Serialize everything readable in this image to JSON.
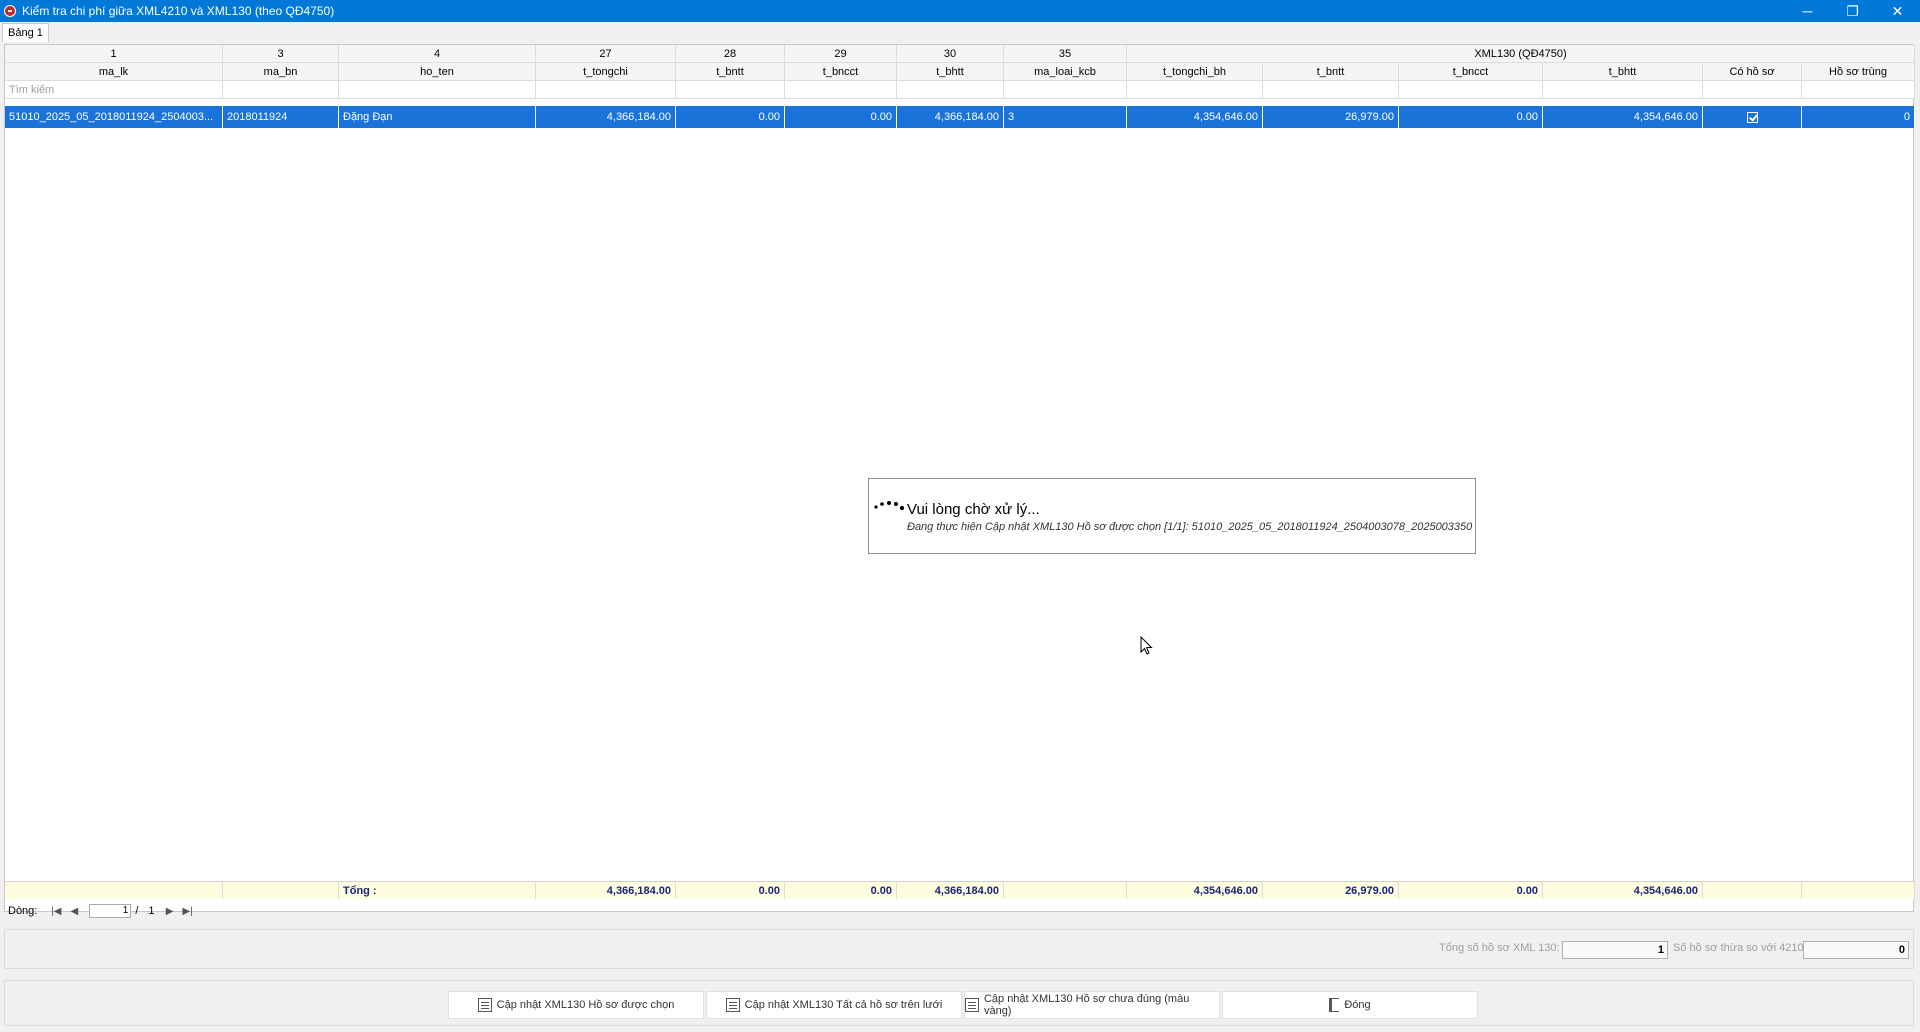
{
  "window": {
    "title": "Kiểm tra chi phí giữa XML4210 và XML130 (theo QĐ4750)",
    "minimize": "─",
    "restore": "❐",
    "close": "✕"
  },
  "tabs": [
    {
      "label": "Bảng 1"
    }
  ],
  "grid": {
    "header_numbers": [
      "1",
      "3",
      "4",
      "27",
      "28",
      "29",
      "30",
      "35"
    ],
    "header_group": "XML130 (QĐ4750)",
    "columns": [
      "ma_lk",
      "ma_bn",
      "ho_ten",
      "t_tongchi",
      "t_bntt",
      "t_bncct",
      "t_bhtt",
      "ma_loai_kcb",
      "t_tongchi_bh",
      "t_bntt",
      "t_bncct",
      "t_bhtt",
      "Có hồ sơ",
      "Hồ sơ trùng"
    ],
    "search_placeholder": "Tìm kiếm",
    "rows": [
      [
        "51010_2025_05_2018011924_2504003...",
        "2018011924",
        "Đặng Đạn",
        "4,366,184.00",
        "0.00",
        "0.00",
        "4,366,184.00",
        "3",
        "4,354,646.00",
        "26,979.00",
        "0.00",
        "4,354,646.00",
        "",
        "0"
      ]
    ],
    "row_checked": true,
    "totals": {
      "label": "Tổng :",
      "values": [
        "4,366,184.00",
        "0.00",
        "0.00",
        "4,366,184.00",
        "",
        "4,354,646.00",
        "26,979.00",
        "0.00",
        "4,354,646.00"
      ]
    }
  },
  "pager": {
    "label": "Dòng:",
    "current_page": "1",
    "separator": "/",
    "total_pages": "1",
    "first": "|◀",
    "prev": "◀",
    "next": "▶",
    "last": "▶|"
  },
  "summary": {
    "total_label": "Tổng số hồ sơ XML 130:",
    "total_value": "1",
    "excess_label": "Số hồ sơ thừa so với 4210:",
    "excess_value": "0"
  },
  "buttons": {
    "update_selected": "Cập nhật XML130 Hồ sơ được chọn",
    "update_all": "Cập nhật XML130 Tất cả hồ sơ trên lưới",
    "update_incorrect": "Cập nhật XML130 Hồ sơ chưa đúng (màu vàng)",
    "close": "Đóng"
  },
  "wait_dialog": {
    "title": "Vui lòng chờ xử lý...",
    "detail": "Đang thực hiện Cập nhật XML130 Hồ sơ được chọn [1/1]: 51010_2025_05_2018011924_2504003078_2025003350"
  },
  "colors": {
    "titlebar": "#0078d7",
    "selected_row": "#1a73d9",
    "totals_background": "#fffde0",
    "totals_text": "#1a237e"
  }
}
